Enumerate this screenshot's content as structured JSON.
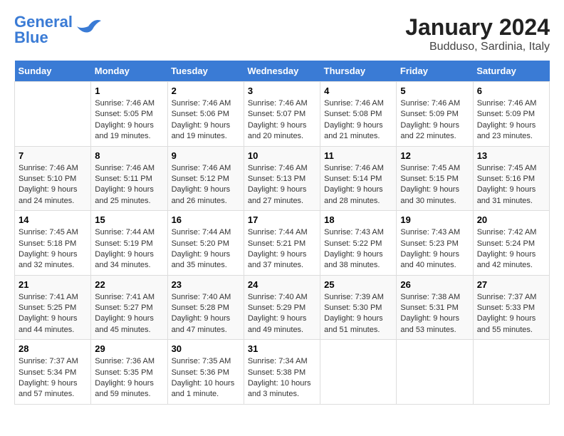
{
  "logo": {
    "line1": "General",
    "line2": "Blue"
  },
  "title": "January 2024",
  "subtitle": "Budduso, Sardinia, Italy",
  "days_header": [
    "Sunday",
    "Monday",
    "Tuesday",
    "Wednesday",
    "Thursday",
    "Friday",
    "Saturday"
  ],
  "weeks": [
    [
      {
        "day": "",
        "info": ""
      },
      {
        "day": "1",
        "info": "Sunrise: 7:46 AM\nSunset: 5:05 PM\nDaylight: 9 hours and 19 minutes."
      },
      {
        "day": "2",
        "info": "Sunrise: 7:46 AM\nSunset: 5:06 PM\nDaylight: 9 hours and 19 minutes."
      },
      {
        "day": "3",
        "info": "Sunrise: 7:46 AM\nSunset: 5:07 PM\nDaylight: 9 hours and 20 minutes."
      },
      {
        "day": "4",
        "info": "Sunrise: 7:46 AM\nSunset: 5:08 PM\nDaylight: 9 hours and 21 minutes."
      },
      {
        "day": "5",
        "info": "Sunrise: 7:46 AM\nSunset: 5:09 PM\nDaylight: 9 hours and 22 minutes."
      },
      {
        "day": "6",
        "info": "Sunrise: 7:46 AM\nSunset: 5:09 PM\nDaylight: 9 hours and 23 minutes."
      }
    ],
    [
      {
        "day": "7",
        "info": "Sunrise: 7:46 AM\nSunset: 5:10 PM\nDaylight: 9 hours and 24 minutes."
      },
      {
        "day": "8",
        "info": "Sunrise: 7:46 AM\nSunset: 5:11 PM\nDaylight: 9 hours and 25 minutes."
      },
      {
        "day": "9",
        "info": "Sunrise: 7:46 AM\nSunset: 5:12 PM\nDaylight: 9 hours and 26 minutes."
      },
      {
        "day": "10",
        "info": "Sunrise: 7:46 AM\nSunset: 5:13 PM\nDaylight: 9 hours and 27 minutes."
      },
      {
        "day": "11",
        "info": "Sunrise: 7:46 AM\nSunset: 5:14 PM\nDaylight: 9 hours and 28 minutes."
      },
      {
        "day": "12",
        "info": "Sunrise: 7:45 AM\nSunset: 5:15 PM\nDaylight: 9 hours and 30 minutes."
      },
      {
        "day": "13",
        "info": "Sunrise: 7:45 AM\nSunset: 5:16 PM\nDaylight: 9 hours and 31 minutes."
      }
    ],
    [
      {
        "day": "14",
        "info": "Sunrise: 7:45 AM\nSunset: 5:18 PM\nDaylight: 9 hours and 32 minutes."
      },
      {
        "day": "15",
        "info": "Sunrise: 7:44 AM\nSunset: 5:19 PM\nDaylight: 9 hours and 34 minutes."
      },
      {
        "day": "16",
        "info": "Sunrise: 7:44 AM\nSunset: 5:20 PM\nDaylight: 9 hours and 35 minutes."
      },
      {
        "day": "17",
        "info": "Sunrise: 7:44 AM\nSunset: 5:21 PM\nDaylight: 9 hours and 37 minutes."
      },
      {
        "day": "18",
        "info": "Sunrise: 7:43 AM\nSunset: 5:22 PM\nDaylight: 9 hours and 38 minutes."
      },
      {
        "day": "19",
        "info": "Sunrise: 7:43 AM\nSunset: 5:23 PM\nDaylight: 9 hours and 40 minutes."
      },
      {
        "day": "20",
        "info": "Sunrise: 7:42 AM\nSunset: 5:24 PM\nDaylight: 9 hours and 42 minutes."
      }
    ],
    [
      {
        "day": "21",
        "info": "Sunrise: 7:41 AM\nSunset: 5:25 PM\nDaylight: 9 hours and 44 minutes."
      },
      {
        "day": "22",
        "info": "Sunrise: 7:41 AM\nSunset: 5:27 PM\nDaylight: 9 hours and 45 minutes."
      },
      {
        "day": "23",
        "info": "Sunrise: 7:40 AM\nSunset: 5:28 PM\nDaylight: 9 hours and 47 minutes."
      },
      {
        "day": "24",
        "info": "Sunrise: 7:40 AM\nSunset: 5:29 PM\nDaylight: 9 hours and 49 minutes."
      },
      {
        "day": "25",
        "info": "Sunrise: 7:39 AM\nSunset: 5:30 PM\nDaylight: 9 hours and 51 minutes."
      },
      {
        "day": "26",
        "info": "Sunrise: 7:38 AM\nSunset: 5:31 PM\nDaylight: 9 hours and 53 minutes."
      },
      {
        "day": "27",
        "info": "Sunrise: 7:37 AM\nSunset: 5:33 PM\nDaylight: 9 hours and 55 minutes."
      }
    ],
    [
      {
        "day": "28",
        "info": "Sunrise: 7:37 AM\nSunset: 5:34 PM\nDaylight: 9 hours and 57 minutes."
      },
      {
        "day": "29",
        "info": "Sunrise: 7:36 AM\nSunset: 5:35 PM\nDaylight: 9 hours and 59 minutes."
      },
      {
        "day": "30",
        "info": "Sunrise: 7:35 AM\nSunset: 5:36 PM\nDaylight: 10 hours and 1 minute."
      },
      {
        "day": "31",
        "info": "Sunrise: 7:34 AM\nSunset: 5:38 PM\nDaylight: 10 hours and 3 minutes."
      },
      {
        "day": "",
        "info": ""
      },
      {
        "day": "",
        "info": ""
      },
      {
        "day": "",
        "info": ""
      }
    ]
  ]
}
